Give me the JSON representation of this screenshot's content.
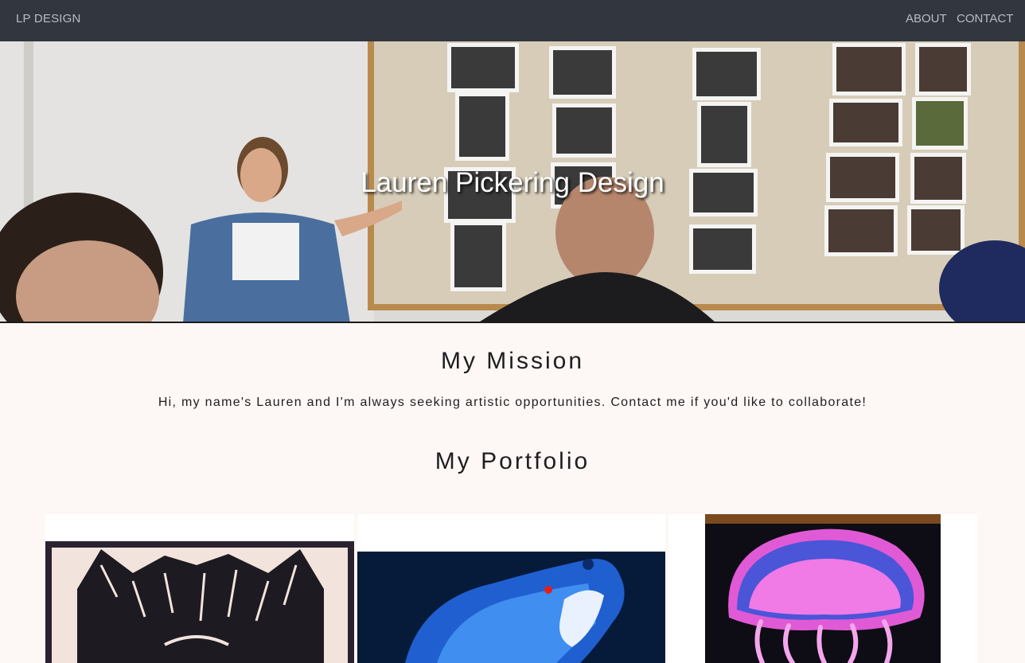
{
  "navbar": {
    "brand": "LP DESIGN",
    "links": [
      {
        "label": "ABOUT"
      },
      {
        "label": "CONTACT"
      }
    ]
  },
  "hero": {
    "title": "Lauren Pickering Design"
  },
  "mission": {
    "heading": "My Mission",
    "text": "Hi, my name's Lauren and I'm always seeking artistic opportunities. Contact me if you'd like to collaborate!"
  },
  "portfolio": {
    "heading": "My Portfolio",
    "items": [
      {
        "name": "wolf-papercut-artwork"
      },
      {
        "name": "blue-bear-painting"
      },
      {
        "name": "pink-jellyfish-painting"
      }
    ]
  },
  "colors": {
    "navbar_bg": "#32363f",
    "nav_text": "#b9bcc2",
    "page_bg": "#fdf8f6",
    "text": "#1e1e1e"
  }
}
